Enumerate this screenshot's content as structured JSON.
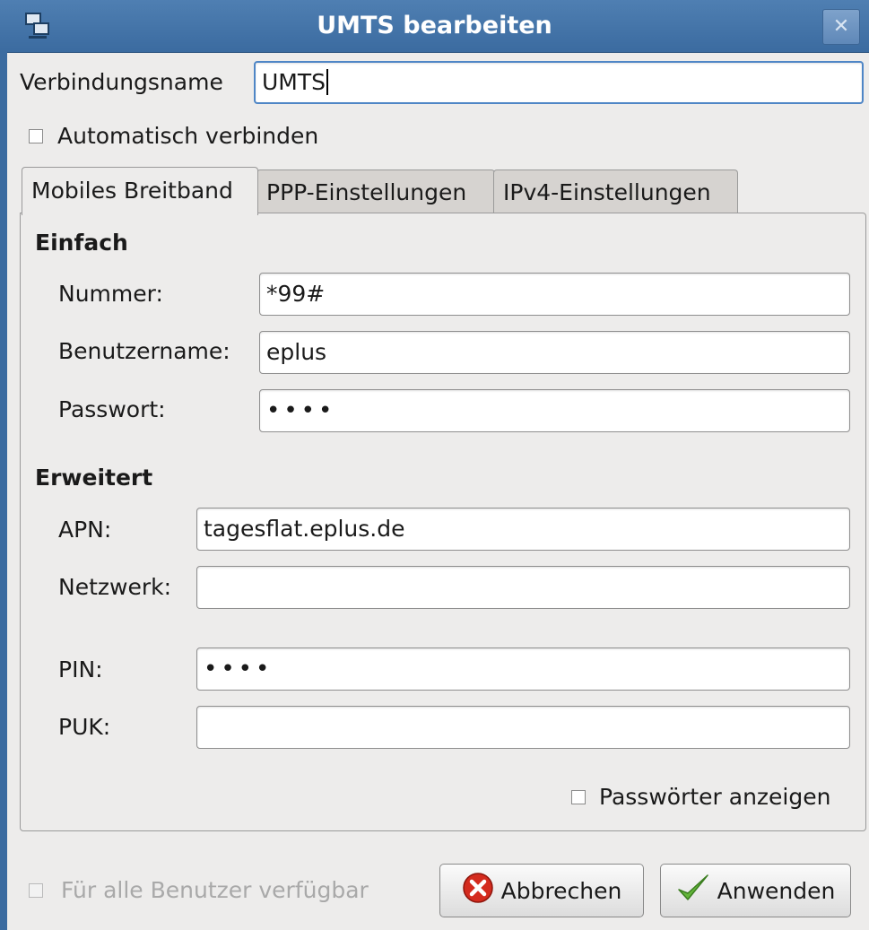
{
  "window": {
    "title": "UMTS bearbeiten",
    "close_glyph": "✕"
  },
  "connection_name": {
    "label": "Verbindungsname",
    "value": "UMTS"
  },
  "auto_connect": {
    "label": "Automatisch verbinden",
    "checked": false
  },
  "tabs": [
    {
      "label": "Mobiles Breitband",
      "active": true
    },
    {
      "label": "PPP-Einstellungen",
      "active": false
    },
    {
      "label": "IPv4-Einstellungen",
      "active": false
    }
  ],
  "basic": {
    "heading": "Einfach",
    "number": {
      "label": "Nummer:",
      "value": "*99#"
    },
    "username": {
      "label": "Benutzername:",
      "value": "eplus"
    },
    "password": {
      "label": "Passwort:",
      "value": "••••"
    }
  },
  "advanced": {
    "heading": "Erweitert",
    "apn": {
      "label": "APN:",
      "value": "tagesflat.eplus.de"
    },
    "network": {
      "label": "Netzwerk:",
      "value": ""
    },
    "pin": {
      "label": "PIN:",
      "value": "••••"
    },
    "puk": {
      "label": "PUK:",
      "value": ""
    }
  },
  "show_passwords": {
    "label": "Passwörter anzeigen",
    "checked": false
  },
  "all_users": {
    "label": "Für alle Benutzer verfügbar",
    "checked": false,
    "enabled": false
  },
  "buttons": {
    "cancel": "Abbrechen",
    "apply": "Anwenden"
  },
  "colors": {
    "titlebar": "#3b6ba0",
    "cancel_icon": "#d42b1e",
    "apply_icon": "#63b53a"
  }
}
